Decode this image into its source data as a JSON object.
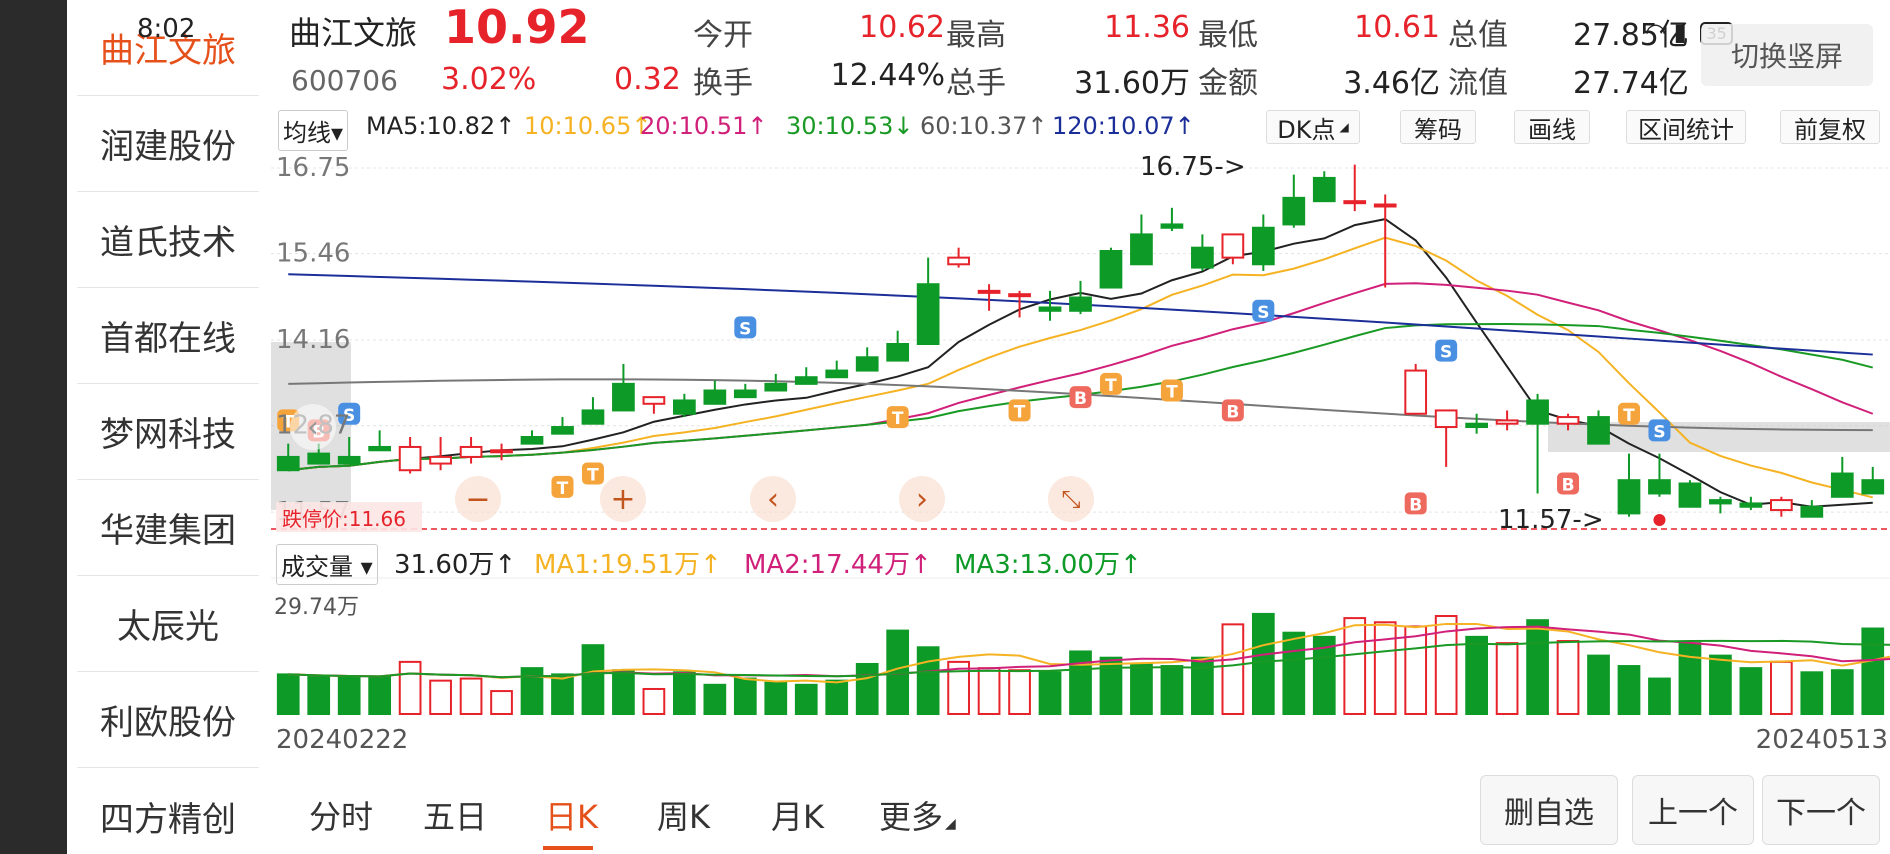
{
  "status": {
    "time": "8:02",
    "battery": "35"
  },
  "sidebar": {
    "items": [
      {
        "label": "曲江文旅"
      },
      {
        "label": "润建股份"
      },
      {
        "label": "道氏技术"
      },
      {
        "label": "首都在线"
      },
      {
        "label": "梦网科技"
      },
      {
        "label": "华建集团"
      },
      {
        "label": "太辰光"
      },
      {
        "label": "利欧股份"
      },
      {
        "label": "四方精创"
      }
    ]
  },
  "stock": {
    "name": "曲江文旅",
    "code": "600706",
    "price": "10.92",
    "change_pct": "3.02%",
    "change": "0.32"
  },
  "quote": {
    "open_label": "今开",
    "open": "10.62",
    "high_label": "最高",
    "high": "11.36",
    "low_label": "最低",
    "low": "10.61",
    "mktcap_label": "总值",
    "mktcap": "27.85亿",
    "turnover_label": "换手",
    "turnover": "12.44%",
    "volume_label": "总手",
    "volume": "31.60万",
    "amount_label": "金额",
    "amount": "3.46亿",
    "float_label": "流值",
    "float_cap": "27.74亿"
  },
  "switch_label": "切换竖屏",
  "toolbar": {
    "ma_selector": "均线▾",
    "ma5": "MA5:10.82↑",
    "ma10": "10:10.65↑",
    "ma20": "20:10.51↑",
    "ma30": "30:10.53↓",
    "ma60": "60:10.37↑",
    "ma120": "120:10.07↑",
    "dk": "DK点",
    "chips": "筹码",
    "draw": "画线",
    "range": "区间统计",
    "adjust": "前复权"
  },
  "volume_bar": {
    "selector": "成交量 ▾",
    "vol": "31.60万↑",
    "ma1": "MA1:19.51万↑",
    "ma2": "MA2:17.44万↑",
    "ma3": "MA3:13.00万↑"
  },
  "chart_data": {
    "type": "candlestick",
    "y_ticks": [
      "16.75",
      "15.46",
      "14.16",
      "12.87",
      "11.57"
    ],
    "ylim": [
      11.3,
      16.9
    ],
    "volume_max_label": "29.74万",
    "volume_max": 29.74,
    "start_date": "20240222",
    "end_date": "20240513",
    "high_marker": "16.75->",
    "low_marker": "11.57->",
    "limit_down_label": "跌停价:11.66",
    "limit_down": 11.66,
    "colors": {
      "up": "#e6232a",
      "down": "#0d9a27",
      "ma5": "#222222",
      "ma10": "#f5b324",
      "ma20": "#d0207a",
      "ma30": "#1a9a25",
      "ma60": "#777777",
      "ma120": "#1c2f99"
    },
    "candles": [
      [
        12.4,
        12.6,
        12.2,
        12.2
      ],
      [
        12.45,
        12.6,
        12.3,
        12.3
      ],
      [
        12.4,
        12.7,
        12.3,
        12.3
      ],
      [
        12.55,
        12.8,
        12.5,
        12.5
      ],
      [
        12.2,
        12.7,
        12.15,
        12.55
      ],
      [
        12.3,
        12.7,
        12.2,
        12.4
      ],
      [
        12.4,
        12.7,
        12.3,
        12.55
      ],
      [
        12.5,
        12.6,
        12.35,
        12.5
      ],
      [
        12.7,
        12.8,
        12.6,
        12.6
      ],
      [
        12.85,
        13.0,
        12.75,
        12.75
      ],
      [
        13.1,
        13.3,
        12.9,
        12.9
      ],
      [
        13.5,
        13.8,
        13.1,
        13.1
      ],
      [
        13.2,
        13.3,
        13.05,
        13.3
      ],
      [
        13.25,
        13.35,
        13.0,
        13.05
      ],
      [
        13.4,
        13.55,
        13.2,
        13.2
      ],
      [
        13.4,
        13.5,
        13.3,
        13.3
      ],
      [
        13.5,
        13.65,
        13.4,
        13.4
      ],
      [
        13.6,
        13.75,
        13.5,
        13.5
      ],
      [
        13.7,
        13.85,
        13.6,
        13.6
      ],
      [
        13.9,
        14.05,
        13.7,
        13.7
      ],
      [
        14.1,
        14.3,
        13.85,
        13.85
      ],
      [
        15.0,
        15.4,
        14.1,
        14.1
      ],
      [
        15.3,
        15.55,
        15.25,
        15.4
      ],
      [
        14.9,
        15.0,
        14.6,
        14.9
      ],
      [
        14.85,
        14.9,
        14.5,
        14.85
      ],
      [
        14.65,
        14.9,
        14.45,
        14.6
      ],
      [
        14.8,
        15.05,
        14.55,
        14.6
      ],
      [
        15.5,
        15.55,
        14.95,
        14.95
      ],
      [
        15.75,
        16.05,
        15.3,
        15.3
      ],
      [
        15.9,
        16.15,
        15.8,
        15.85
      ],
      [
        15.55,
        15.75,
        15.2,
        15.25
      ],
      [
        15.4,
        15.75,
        15.3,
        15.75
      ],
      [
        15.85,
        16.05,
        15.2,
        15.3
      ],
      [
        16.3,
        16.65,
        15.85,
        15.9
      ],
      [
        16.6,
        16.7,
        16.25,
        16.25
      ],
      [
        16.25,
        16.8,
        16.1,
        16.25
      ],
      [
        16.2,
        16.35,
        14.95,
        16.2
      ],
      [
        13.05,
        13.8,
        13.05,
        13.7
      ],
      [
        12.85,
        13.1,
        12.25,
        13.1
      ],
      [
        12.9,
        13.05,
        12.75,
        12.85
      ],
      [
        12.9,
        13.1,
        12.8,
        12.95
      ],
      [
        13.25,
        13.35,
        11.85,
        12.9
      ],
      [
        12.9,
        13.05,
        12.8,
        13.0
      ],
      [
        13.0,
        13.1,
        12.6,
        12.6
      ],
      [
        12.05,
        12.45,
        11.5,
        11.55
      ],
      [
        12.05,
        12.45,
        11.8,
        11.85
      ],
      [
        12.0,
        12.05,
        11.65,
        11.65
      ],
      [
        11.75,
        11.8,
        11.55,
        11.7
      ],
      [
        11.7,
        11.8,
        11.6,
        11.65
      ],
      [
        11.6,
        11.8,
        11.5,
        11.75
      ],
      [
        11.65,
        11.75,
        11.5,
        11.5
      ],
      [
        12.15,
        12.4,
        11.8,
        11.8
      ],
      [
        12.05,
        12.25,
        11.85,
        11.85
      ]
    ],
    "volumes": [
      9.5,
      9.0,
      8.8,
      8.8,
      12.5,
      8.0,
      8.5,
      5.5,
      11.0,
      9.5,
      16.5,
      10.5,
      6.0,
      10.0,
      7.0,
      8.5,
      7.5,
      7.0,
      8.0,
      12.0,
      20.0,
      16.0,
      12.5,
      11.0,
      10.5,
      10.0,
      15.0,
      13.5,
      12.0,
      11.5,
      13.5,
      21.5,
      24.0,
      19.5,
      18.5,
      23.0,
      22.0,
      21.0,
      23.5,
      18.5,
      17.0,
      22.5,
      17.5,
      14.0,
      11.5,
      8.5,
      17.0,
      14.0,
      11.0,
      12.5,
      10.0,
      10.5,
      20.5,
      18.5
    ]
  },
  "tabs": [
    {
      "label": "分时"
    },
    {
      "label": "五日"
    },
    {
      "label": "日K"
    },
    {
      "label": "周K"
    },
    {
      "label": "月K"
    },
    {
      "label": "更多"
    }
  ],
  "buttons": {
    "remove_watch": "删自选",
    "prev": "上一个",
    "next": "下一个"
  },
  "nav": {
    "zoom_out": "−",
    "zoom_in": "+",
    "left": "‹",
    "right": "›"
  }
}
